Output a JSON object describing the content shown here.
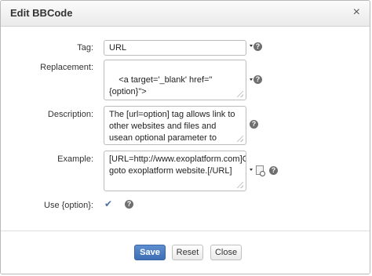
{
  "dialog": {
    "title": "Edit BBCode",
    "close_glyph": "×"
  },
  "form": {
    "tag": {
      "label": "Tag:",
      "value": "URL"
    },
    "replacement": {
      "label": "Replacement:",
      "value": "<a target='_blank' href=\"{option}\">\n{param}</a>"
    },
    "description": {
      "label": "Description:",
      "value": "The [url=option] tag allows link to other websites and files and usean optional parameter to 'name' of thislink."
    },
    "example": {
      "label": "Example:",
      "value": "[URL=http://www.exoplatform.com]Click goto exoplatform website.[/URL]"
    },
    "use_option": {
      "label": "Use {option}:",
      "checked": true,
      "glyph": "✔"
    },
    "help_glyph": "?"
  },
  "buttons": {
    "save": "Save",
    "reset": "Reset",
    "close": "Close"
  },
  "colors": {
    "primary_button": "#4a7bc2",
    "help_icon": "#6f6f6f",
    "checkbox": "#4a6ea0"
  },
  "icons": [
    "close-icon",
    "dropdown-caret-icon",
    "help-icon",
    "preview-icon",
    "checkmark-icon",
    "resize-grip-icon"
  ]
}
